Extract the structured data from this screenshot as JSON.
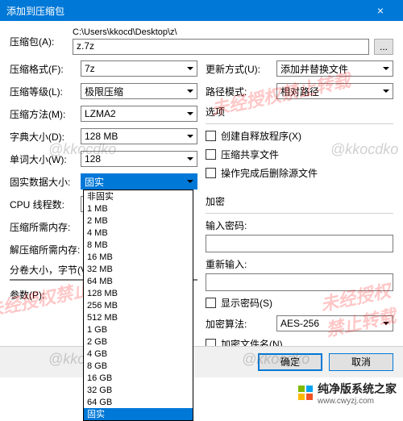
{
  "title": "添加到压缩包",
  "archive_label": "压缩包(A):",
  "path_text": "C:\\Users\\kkocd\\Desktop\\z\\",
  "archive_name": "z.7z",
  "browse_label": "...",
  "left": {
    "format_label": "压缩格式(F):",
    "format_value": "7z",
    "level_label": "压缩等级(L):",
    "level_value": "极限压缩",
    "method_label": "压缩方法(M):",
    "method_value": "LZMA2",
    "dict_label": "字典大小(D):",
    "dict_value": "128 MB",
    "word_label": "单词大小(W):",
    "word_value": "128",
    "solid_label": "固实数据大小:",
    "solid_value": "固实",
    "cpu_label": "CPU 线程数:",
    "cpu_value": "",
    "mem_compress_label": "压缩所需内存:",
    "mem_compress_value": "",
    "mem_decompress_label": "解压缩所需内存:",
    "mem_decompress_value": "",
    "split_label": "分卷大小，字节(V):",
    "split_value": "",
    "params_label": "参数(P):",
    "params_value": ""
  },
  "right": {
    "update_label": "更新方式(U):",
    "update_value": "添加并替换文件",
    "pathmode_label": "路径模式:",
    "pathmode_value": "相对路径",
    "options_title": "选项",
    "opt_sfx": "创建自释放程序(X)",
    "opt_share": "压缩共享文件",
    "opt_delete": "操作完成后删除源文件",
    "encrypt_title": "加密",
    "pwd_label": "输入密码:",
    "pwd2_label": "重新输入:",
    "show_pwd": "显示密码(S)",
    "algo_label": "加密算法:",
    "algo_value": "AES-256",
    "encrypt_names": "加密文件名(N)"
  },
  "dropdown_options": [
    "非固实",
    "1 MB",
    "2 MB",
    "4 MB",
    "8 MB",
    "16 MB",
    "32 MB",
    "64 MB",
    "128 MB",
    "256 MB",
    "512 MB",
    "1 GB",
    "2 GB",
    "4 GB",
    "8 GB",
    "16 GB",
    "32 GB",
    "64 GB",
    "固实"
  ],
  "dropdown_selected": "固实",
  "buttons": {
    "ok": "确定",
    "cancel": "取消"
  },
  "watermark_red": "未经授权禁止转载",
  "watermark_gray": "@kkocdko",
  "footer": {
    "brand": "纯净版系统之家",
    "url": "www.cwyzj.com"
  }
}
